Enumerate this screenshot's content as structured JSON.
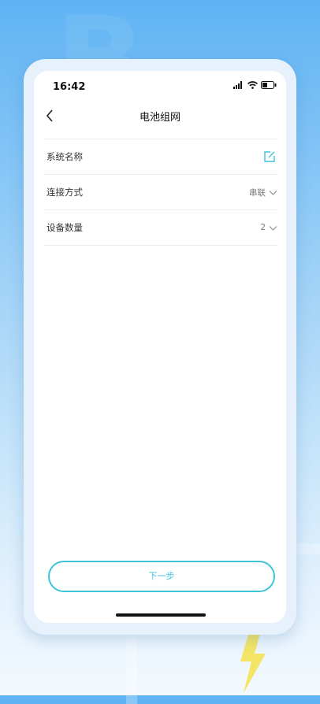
{
  "status": {
    "time": "16:42"
  },
  "header": {
    "title": "电池组网"
  },
  "settings": [
    {
      "label": "系统名称",
      "value": "",
      "icon": "edit-icon"
    },
    {
      "label": "连接方式",
      "value": "串联",
      "icon": "chevron-down-icon"
    },
    {
      "label": "设备数量",
      "value": "2",
      "icon": "chevron-down-icon"
    }
  ],
  "footer": {
    "next_label": "下一步"
  },
  "colors": {
    "accent": "#3cc4d8"
  }
}
